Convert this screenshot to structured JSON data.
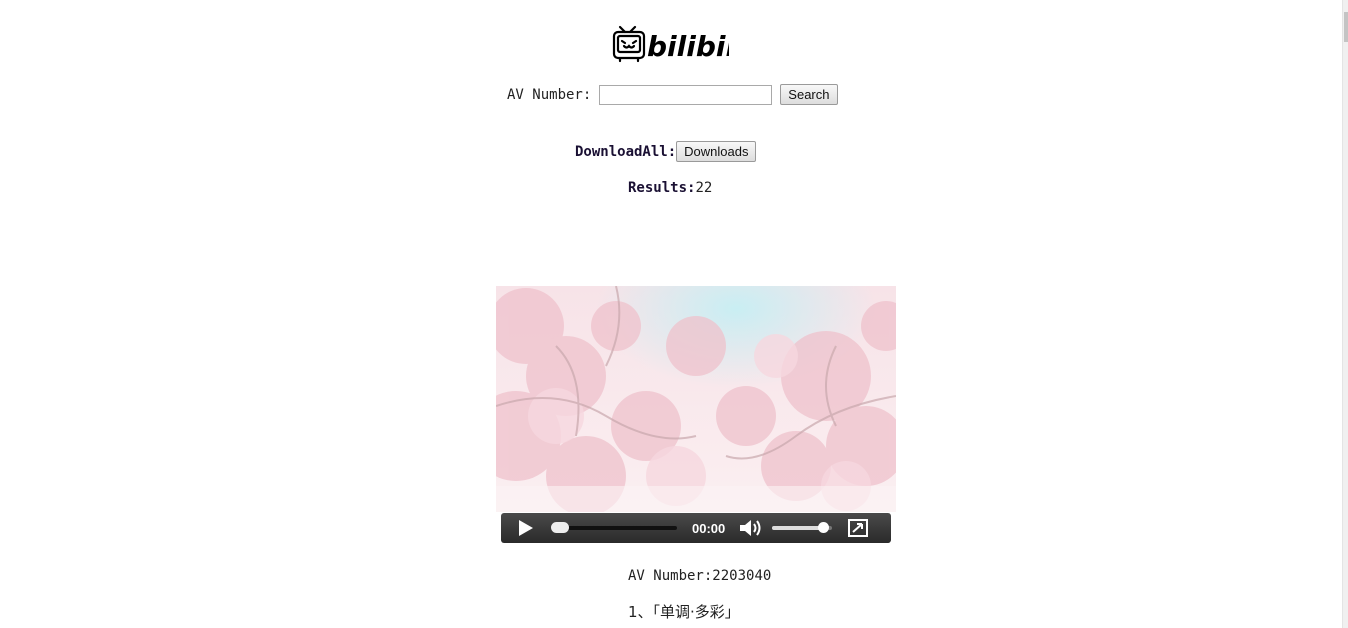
{
  "logo_text": "bilibili",
  "search": {
    "label": "AV Number:",
    "input_value": "",
    "button_label": "Search"
  },
  "download_all": {
    "label": "DownloadAll:",
    "button_label": "Downloads"
  },
  "results": {
    "label": "Results:",
    "count": "22"
  },
  "player": {
    "time": "00:00",
    "progress_fraction": 0.0,
    "volume_fraction": 0.93,
    "icons": [
      "play-icon",
      "volume-icon",
      "fullscreen-icon"
    ]
  },
  "items": [
    {
      "av_label": "AV Number:",
      "av_value": "2203040",
      "title": "1、「单调·多彩」"
    }
  ],
  "colors": {
    "label_text": "#1a1033",
    "controls_bg": "#333333"
  }
}
